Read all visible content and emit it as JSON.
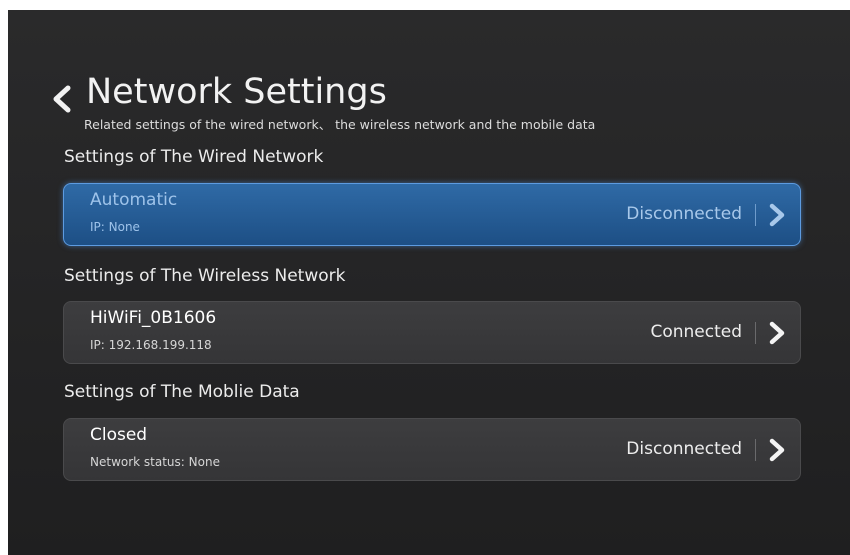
{
  "header": {
    "title": "Network Settings",
    "subtitle": "Related settings of the wired network、 the wireless network and the mobile data"
  },
  "sections": [
    {
      "title": "Settings of The Wired Network",
      "name": "Automatic",
      "detail": "IP: None",
      "status": "Disconnected",
      "selected": true
    },
    {
      "title": "Settings of The Wireless Network",
      "name": "HiWiFi_0B1606",
      "detail": "IP: 192.168.199.118",
      "status": "Connected",
      "selected": false
    },
    {
      "title": "Settings of The Moblie Data",
      "name": "Closed",
      "detail": "Network status: None",
      "status": "Disconnected",
      "selected": false
    }
  ],
  "icons": {
    "back": "chevron-left-icon",
    "row_arrow": "chevron-right-icon"
  },
  "colors": {
    "background": "#232324",
    "card": "#3a3a3c",
    "selected_card": "#2a5f97",
    "selected_border": "#5d9be0",
    "text": "#f2f2f2"
  }
}
